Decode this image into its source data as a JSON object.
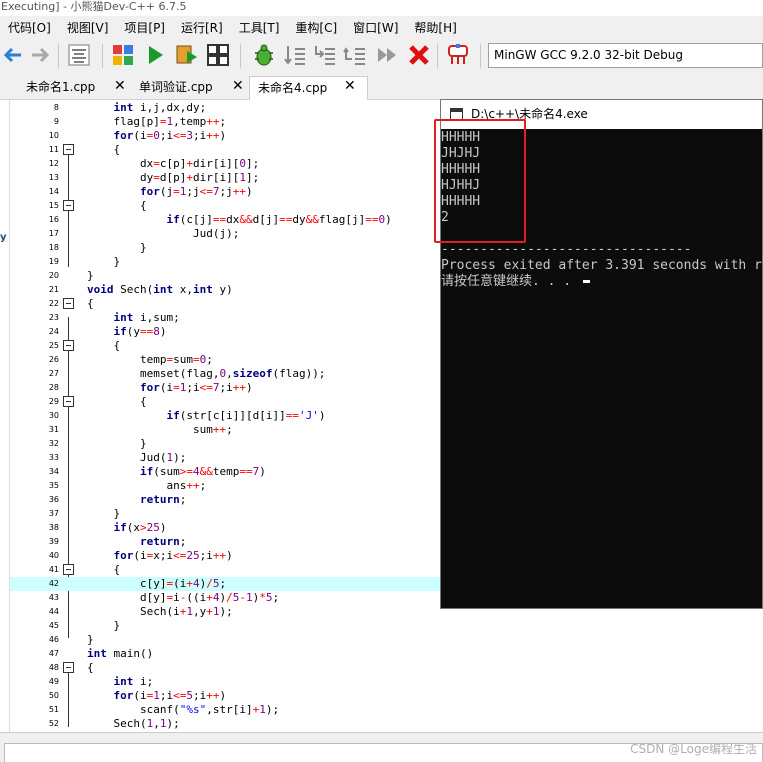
{
  "window": {
    "title": "Executing] - 小熊猫Dev-C++ 6.7.5"
  },
  "menu": [
    "代码[O]",
    "视图[V]",
    "项目[P]",
    "运行[R]",
    "工具[T]",
    "重构[C]",
    "窗口[W]",
    "帮助[H]"
  ],
  "toolbar": {
    "compiler": "MinGW GCC 9.2.0 32-bit Debug"
  },
  "tabs": [
    {
      "label": "未命名1.cpp",
      "close": "✕"
    },
    {
      "label": "单词验证.cpp",
      "close": "✕"
    },
    {
      "label": "未命名4.cpp",
      "close": "✕"
    }
  ],
  "sidebar": {
    "text": "y"
  },
  "editor": {
    "current_line": "42",
    "lines": [
      {
        "num": "8",
        "html": "    <span class=\"t\">int</span> i,j,dx,dy;"
      },
      {
        "num": "9",
        "html": "    flag[p]<span class=\"o\">=</span><span class=\"n\">1</span>,temp<span class=\"o\">++</span>;"
      },
      {
        "num": "10",
        "html": "    <span class=\"k\">for</span>(i<span class=\"o\">=</span><span class=\"n\">0</span>;i<span class=\"o\">&lt;=</span><span class=\"n\">3</span>;i<span class=\"o\">++</span>)"
      },
      {
        "num": "11",
        "html": "    {"
      },
      {
        "num": "12",
        "html": "        dx<span class=\"o\">=</span>c[p]<span class=\"o\">+</span>dir[i][<span class=\"n\">0</span>];"
      },
      {
        "num": "13",
        "html": "        dy<span class=\"o\">=</span>d[p]<span class=\"o\">+</span>dir[i][<span class=\"n\">1</span>];"
      },
      {
        "num": "14",
        "html": "        <span class=\"k\">for</span>(j<span class=\"o\">=</span><span class=\"n\">1</span>;j<span class=\"o\">&lt;=</span><span class=\"n\">7</span>;j<span class=\"o\">++</span>)"
      },
      {
        "num": "15",
        "html": "        {"
      },
      {
        "num": "16",
        "html": "            <span class=\"k\">if</span>(c[j]<span class=\"o\">==</span>dx<span class=\"o\">&amp;&amp;</span>d[j]<span class=\"o\">==</span>dy<span class=\"o\">&amp;&amp;</span>flag[j]<span class=\"o\">==</span><span class=\"n\">0</span>)"
      },
      {
        "num": "17",
        "html": "                Jud(j);"
      },
      {
        "num": "18",
        "html": "        }"
      },
      {
        "num": "19",
        "html": "    }"
      },
      {
        "num": "20",
        "html": "}"
      },
      {
        "num": "21",
        "html": "<span class=\"t\">void</span> Sech(<span class=\"t\">int</span> x,<span class=\"t\">int</span> y)"
      },
      {
        "num": "22",
        "html": "{"
      },
      {
        "num": "23",
        "html": "    <span class=\"t\">int</span> i,sum;"
      },
      {
        "num": "24",
        "html": "    <span class=\"k\">if</span>(y<span class=\"o\">==</span><span class=\"n\">8</span>)"
      },
      {
        "num": "25",
        "html": "    {"
      },
      {
        "num": "26",
        "html": "        temp<span class=\"o\">=</span>sum<span class=\"o\">=</span><span class=\"n\">0</span>;"
      },
      {
        "num": "27",
        "html": "        memset(flag,<span class=\"n\">0</span>,<span class=\"k\">sizeof</span>(flag));"
      },
      {
        "num": "28",
        "html": "        <span class=\"k\">for</span>(i<span class=\"o\">=</span><span class=\"n\">1</span>;i<span class=\"o\">&lt;=</span><span class=\"n\">7</span>;i<span class=\"o\">++</span>)"
      },
      {
        "num": "29",
        "html": "        {"
      },
      {
        "num": "30",
        "html": "            <span class=\"k\">if</span>(str[c[i]][d[i]]<span class=\"o\">==</span><span class=\"s\">'J'</span>)"
      },
      {
        "num": "31",
        "html": "                sum<span class=\"o\">++</span>;"
      },
      {
        "num": "32",
        "html": "        }"
      },
      {
        "num": "33",
        "html": "        Jud(<span class=\"n\">1</span>);"
      },
      {
        "num": "34",
        "html": "        <span class=\"k\">if</span>(sum<span class=\"o\">&gt;=</span><span class=\"n\">4</span><span class=\"o\">&amp;&amp;</span>temp<span class=\"o\">==</span><span class=\"n\">7</span>)"
      },
      {
        "num": "35",
        "html": "            ans<span class=\"o\">++</span>;"
      },
      {
        "num": "36",
        "html": "        <span class=\"k\">return</span>;"
      },
      {
        "num": "37",
        "html": "    }"
      },
      {
        "num": "38",
        "html": "    <span class=\"k\">if</span>(x<span class=\"o\">&gt;</span><span class=\"n\">25</span>)"
      },
      {
        "num": "39",
        "html": "        <span class=\"k\">return</span>;"
      },
      {
        "num": "40",
        "html": "    <span class=\"k\">for</span>(i<span class=\"o\">=</span>x;i<span class=\"o\">&lt;=</span><span class=\"n\">25</span>;i<span class=\"o\">++</span>)"
      },
      {
        "num": "41",
        "html": "    {"
      },
      {
        "num": "42",
        "html": "        c[y]<span class=\"o\">=</span>(i<span class=\"o\">+</span><span class=\"n\">4</span>)<span class=\"o\">/</span><span class=\"n\">5</span>;"
      },
      {
        "num": "43",
        "html": "        d[y]<span class=\"o\">=</span>i<span class=\"o\">-</span>((i<span class=\"o\">+</span><span class=\"n\">4</span>)<span class=\"o\">/</span><span class=\"n\">5</span><span class=\"o\">-</span><span class=\"n\">1</span>)<span class=\"o\">*</span><span class=\"n\">5</span>;"
      },
      {
        "num": "44",
        "html": "        Sech(i<span class=\"o\">+</span><span class=\"n\">1</span>,y<span class=\"o\">+</span><span class=\"n\">1</span>);"
      },
      {
        "num": "45",
        "html": "    }"
      },
      {
        "num": "46",
        "html": "}"
      },
      {
        "num": "47",
        "html": "<span class=\"t\">int</span> main()"
      },
      {
        "num": "48",
        "html": "{"
      },
      {
        "num": "49",
        "html": "    <span class=\"t\">int</span> i;"
      },
      {
        "num": "50",
        "html": "    <span class=\"k\">for</span>(i<span class=\"o\">=</span><span class=\"n\">1</span>;i<span class=\"o\">&lt;=</span><span class=\"n\">5</span>;i<span class=\"o\">++</span>)"
      },
      {
        "num": "51",
        "html": "        scanf(<span class=\"s\">\"%s\"</span>,str[i]<span class=\"o\">+</span><span class=\"n\">1</span>);"
      },
      {
        "num": "52",
        "html": "    Sech(<span class=\"n\">1</span>,<span class=\"n\">1</span>);"
      }
    ]
  },
  "console": {
    "title": "D:\\c++\\未命名4.exe",
    "lines": [
      "HHHHH",
      "JHJHJ",
      "HHHHH",
      "HJHHJ",
      "HHHHH",
      "2",
      "",
      "--------------------------------",
      "Process exited after 3.391 seconds with r",
      "请按任意键继续. . . "
    ]
  },
  "watermark": "CSDN @Loge编程生活"
}
